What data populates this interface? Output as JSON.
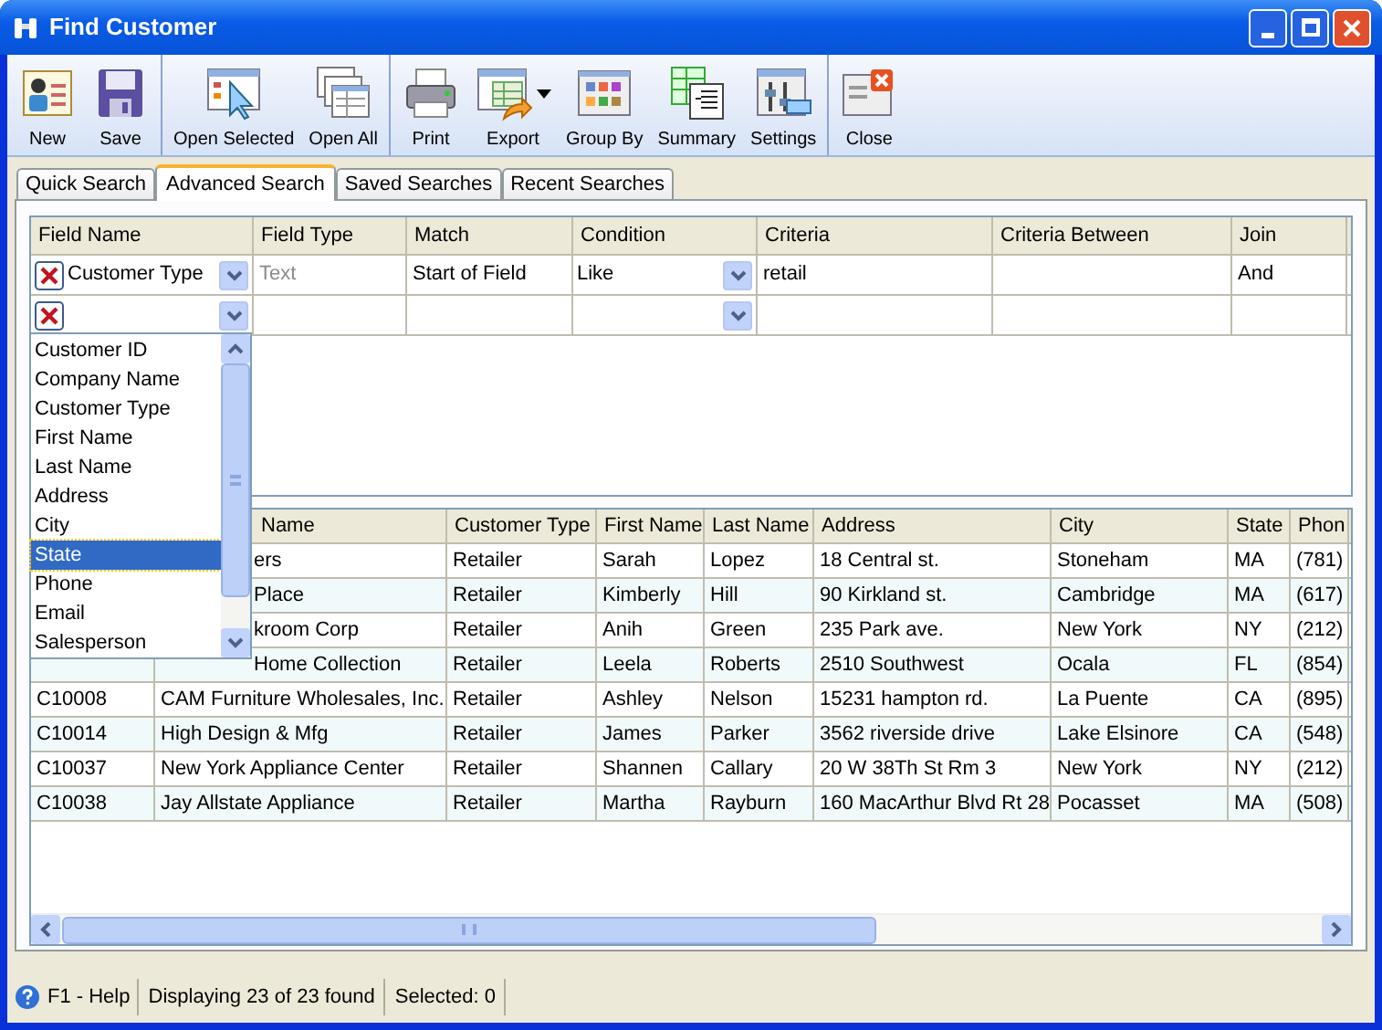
{
  "window": {
    "title": "Find Customer"
  },
  "toolbar": [
    [
      {
        "label": "New",
        "has_menu": false
      },
      {
        "label": "Save",
        "has_menu": false
      }
    ],
    [
      {
        "label": "Open Selected",
        "has_menu": false
      },
      {
        "label": "Open All",
        "has_menu": false
      }
    ],
    [
      {
        "label": "Print",
        "has_menu": false
      },
      {
        "label": "Export",
        "has_menu": true
      },
      {
        "label": "Group By",
        "has_menu": false
      },
      {
        "label": "Summary",
        "has_menu": false
      },
      {
        "label": "Settings",
        "has_menu": false
      }
    ],
    [
      {
        "label": "Close",
        "has_menu": false
      }
    ]
  ],
  "tabs": [
    {
      "label": "Quick Search",
      "selected": false
    },
    {
      "label": "Advanced Search",
      "selected": true
    },
    {
      "label": "Saved Searches",
      "selected": false
    },
    {
      "label": "Recent Searches",
      "selected": false
    }
  ],
  "criteria": {
    "columns": [
      "Field Name",
      "Field Type",
      "Match",
      "Condition",
      "Criteria",
      "Criteria Between",
      "Join"
    ],
    "rows": [
      {
        "field": "Customer Type",
        "field_type": "Text",
        "match": "Start of Field",
        "condition": "Like",
        "criteria": "retail",
        "join": "And"
      },
      {}
    ],
    "dropdown": [
      {
        "label": "Customer ID",
        "selected": false
      },
      {
        "label": "Company Name",
        "selected": false
      },
      {
        "label": "Customer Type",
        "selected": false
      },
      {
        "label": "First Name",
        "selected": false
      },
      {
        "label": "Last Name",
        "selected": false
      },
      {
        "label": "Address",
        "selected": false
      },
      {
        "label": "City",
        "selected": false
      },
      {
        "label": "State",
        "selected": true
      },
      {
        "label": "Phone",
        "selected": false
      },
      {
        "label": "Email",
        "selected": false
      },
      {
        "label": "Salesperson",
        "selected": false
      }
    ]
  },
  "results": {
    "columns": [
      "Name",
      "Customer Type",
      "First Name",
      "Last Name",
      "Address",
      "City",
      "State",
      "Phon"
    ],
    "rows": [
      {
        "covered": true,
        "company": "ers",
        "type": "Retailer",
        "first": "Sarah",
        "last": "Lopez",
        "address": "18 Central st.",
        "city": "Stoneham",
        "state": "MA",
        "phone": "(781)"
      },
      {
        "covered": true,
        "company": "Place",
        "type": "Retailer",
        "first": "Kimberly",
        "last": "Hill",
        "address": "90 Kirkland st.",
        "city": "Cambridge",
        "state": "MA",
        "phone": "(617)"
      },
      {
        "covered": true,
        "company": "kroom Corp",
        "type": "Retailer",
        "first": "Anih",
        "last": "Green",
        "address": "235 Park ave.",
        "city": "New York",
        "state": "NY",
        "phone": "(212)"
      },
      {
        "covered": true,
        "company": "Home Collection",
        "type": "Retailer",
        "first": "Leela",
        "last": "Roberts",
        "address": "2510 Southwest",
        "city": "Ocala",
        "state": "FL",
        "phone": "(854)"
      },
      {
        "covered": false,
        "id": "C10008",
        "company": "CAM Furniture Wholesales, Inc.",
        "type": "Retailer",
        "first": "Ashley",
        "last": "Nelson",
        "address": "15231 hampton rd.",
        "city": "La Puente",
        "state": "CA",
        "phone": "(895)"
      },
      {
        "covered": false,
        "id": "C10014",
        "company": "High Design & Mfg",
        "type": "Retailer",
        "first": "James",
        "last": "Parker",
        "address": "3562 riverside drive",
        "city": "Lake Elsinore",
        "state": "CA",
        "phone": "(548)"
      },
      {
        "covered": false,
        "id": "C10037",
        "company": "New York Appliance Center",
        "type": "Retailer",
        "first": "Shannen",
        "last": "Callary",
        "address": "20 W 38Th St Rm 3",
        "city": "New York",
        "state": "NY",
        "phone": "(212)"
      },
      {
        "covered": false,
        "id": "C10038",
        "company": "Jay Allstate Appliance",
        "type": "Retailer",
        "first": "Martha",
        "last": "Rayburn",
        "address": "160 MacArthur Blvd Rt 28",
        "city": "Pocasset",
        "state": "MA",
        "phone": "(508)"
      }
    ]
  },
  "status_bar": {
    "help": "F1 - Help",
    "count": "Displaying 23 of 23 found",
    "selected": "Selected: 0"
  }
}
